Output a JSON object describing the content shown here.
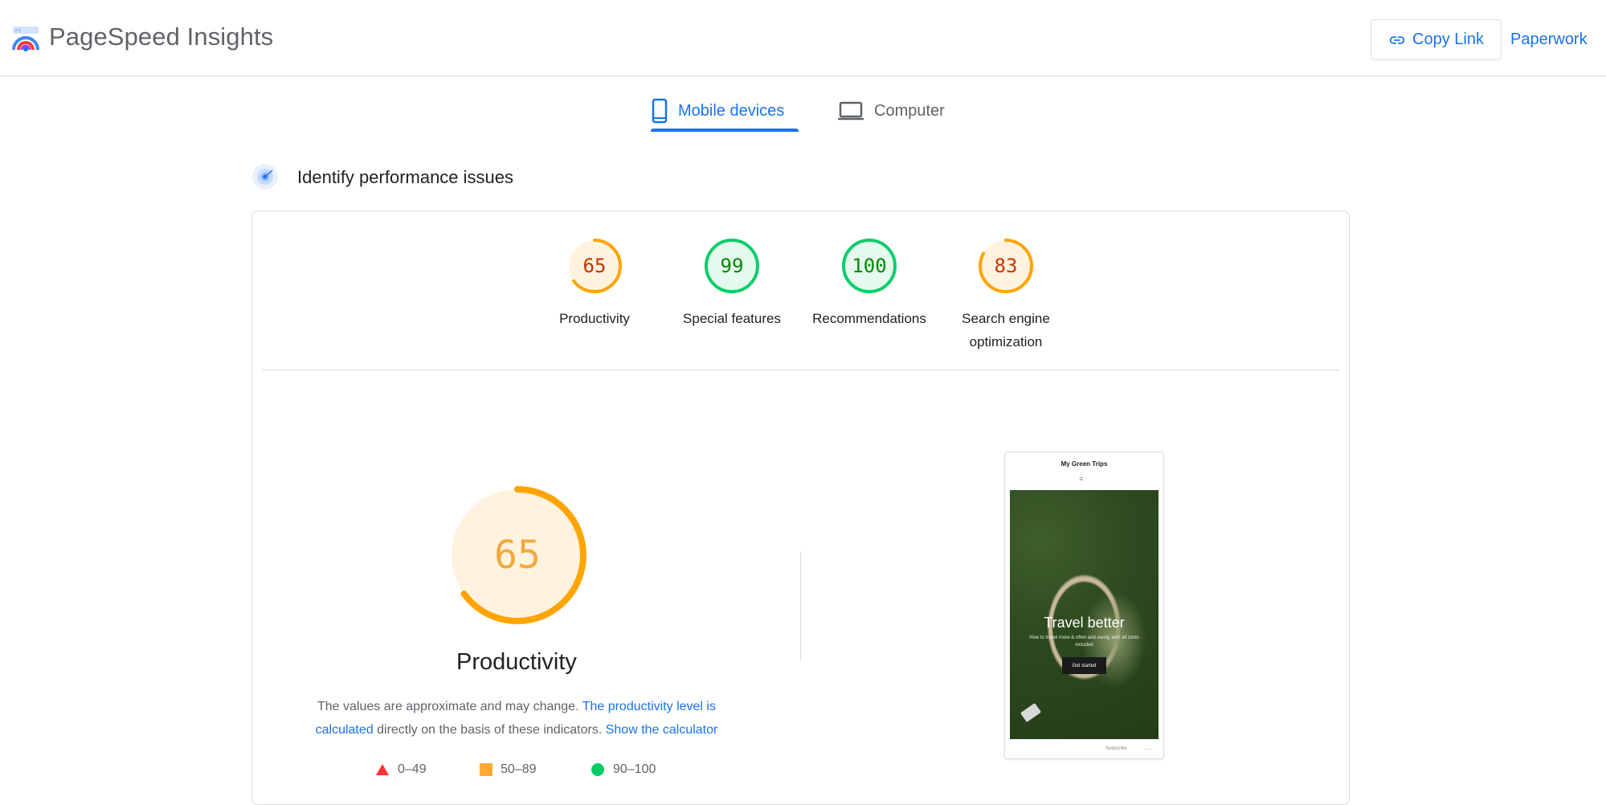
{
  "header": {
    "title": "PageSpeed Insights",
    "copy_link_label": "Copy Link",
    "paperwork_label": "Paperwork"
  },
  "tabs": [
    {
      "label": "Mobile devices",
      "active": true,
      "icon": "smartphone-icon"
    },
    {
      "label": "Computer",
      "active": false,
      "icon": "laptop-icon"
    }
  ],
  "section": {
    "title": "Identify performance issues"
  },
  "scores": [
    {
      "value": 65,
      "label_lines": [
        "Productivity"
      ],
      "status": "average"
    },
    {
      "value": 99,
      "label_lines": [
        "Special features"
      ],
      "status": "good"
    },
    {
      "value": 100,
      "label_lines": [
        "Recommendations"
      ],
      "status": "good"
    },
    {
      "value": 83,
      "label_lines": [
        "Search engine",
        "optimization"
      ],
      "status": "average"
    }
  ],
  "main_score": {
    "value": 65,
    "title": "Productivity",
    "description_prefix": "The values are approximate and may change. ",
    "description_link": "The productivity level is calculated",
    "description_middle": " directly on the basis of these indicators.  ",
    "calculator_link": "Show the calculator"
  },
  "legend": [
    {
      "range": "0–49",
      "shape": "triangle",
      "color": "#f33"
    },
    {
      "range": "50–89",
      "shape": "square",
      "color": "#fa3"
    },
    {
      "range": "90–100",
      "shape": "circle",
      "color": "#0c6"
    }
  ],
  "screenshot": {
    "site_title": "My Green Trips",
    "menu_glyph": "≡",
    "hero_title": "Travel better",
    "hero_subtitle": "How to travel more & often and easily, with all costs included",
    "hero_button": "Get started",
    "subscribe_label": "Subscribe",
    "more_glyph": "···"
  },
  "colors": {
    "accent": "#1a73e8",
    "good": "#0cce6b",
    "good_text": "#008800",
    "good_bg": "#e6f9ee",
    "average": "#ffa400",
    "average_text": "#c33300",
    "average_bg": "#fff3e0",
    "big_text": "#f5a83b"
  }
}
